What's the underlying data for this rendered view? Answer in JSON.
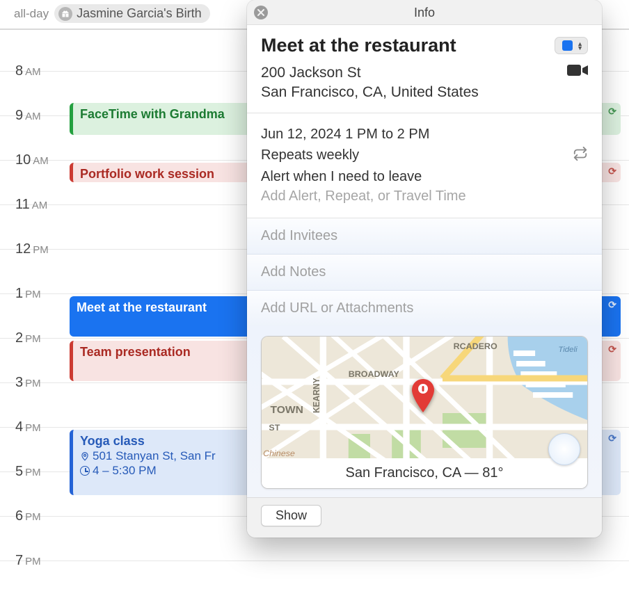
{
  "allday": {
    "label": "all-day",
    "chip": "Jasmine Garcia's Birth"
  },
  "hours": [
    {
      "num": "8",
      "ampm": "AM"
    },
    {
      "num": "9",
      "ampm": "AM"
    },
    {
      "num": "10",
      "ampm": "AM"
    },
    {
      "num": "11",
      "ampm": "AM"
    },
    {
      "num": "12",
      "ampm": "PM"
    },
    {
      "num": "1",
      "ampm": "PM"
    },
    {
      "num": "2",
      "ampm": "PM"
    },
    {
      "num": "3",
      "ampm": "PM"
    },
    {
      "num": "4",
      "ampm": "PM"
    },
    {
      "num": "5",
      "ampm": "PM"
    },
    {
      "num": "6",
      "ampm": "PM"
    },
    {
      "num": "7",
      "ampm": "PM"
    }
  ],
  "events": {
    "facetime": "FaceTime with Grandma",
    "portfolio": "Portfolio work session",
    "meet": "Meet at the restaurant",
    "team": "Team presentation",
    "yoga_title": "Yoga class",
    "yoga_loc": "501 Stanyan St, San Fr",
    "yoga_time": "4 – 5:30 PM"
  },
  "popover": {
    "header": "Info",
    "title": "Meet at the restaurant",
    "address_line1": "200 Jackson St",
    "address_line2": "San Francisco, CA, United States",
    "datetime": "Jun 12, 2024  1 PM to 2 PM",
    "repeats": "Repeats weekly",
    "alert": "Alert when I need to leave",
    "add_alert": "Add Alert, Repeat, or Travel Time",
    "add_invitees": "Add Invitees",
    "add_notes": "Add Notes",
    "add_url": "Add URL or Attachments",
    "map_footer": "San Francisco, CA — 81°",
    "show_btn": "Show",
    "calendar_color": "#1a73f0",
    "map_streets": {
      "broadway": "BROADWAY",
      "kearny": "KEARNY",
      "town": "TOWN",
      "st": "ST",
      "chinese": "Chinese",
      "rcadero": "RCADERO",
      "tideli": "Tideli"
    }
  }
}
